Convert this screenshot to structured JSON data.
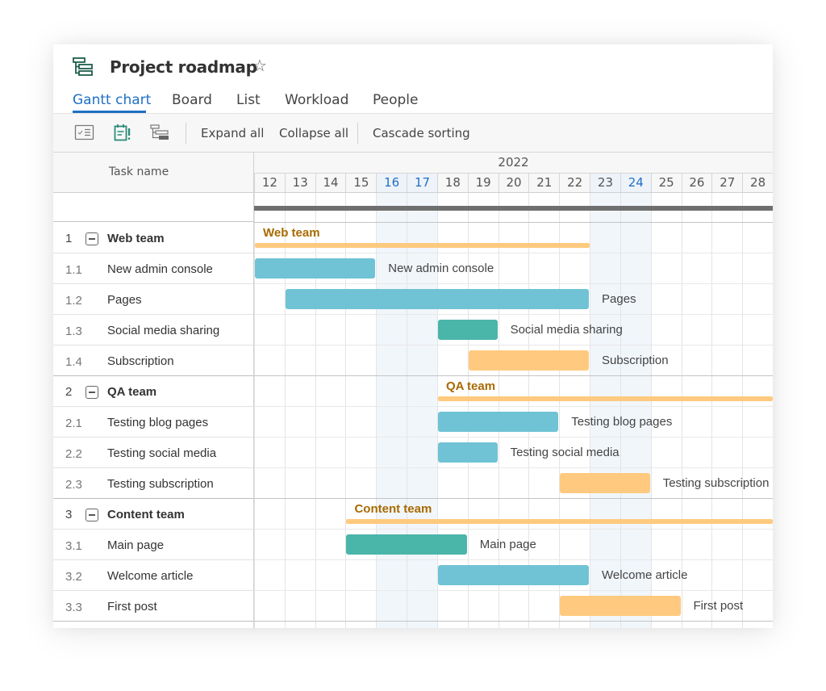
{
  "header": {
    "title": "Project roadmap",
    "app_icon": "gantt-icon",
    "favorite_icon": "star-icon"
  },
  "tabs": [
    {
      "label": "Gantt chart",
      "active": true
    },
    {
      "label": "Board",
      "active": false
    },
    {
      "label": "List",
      "active": false
    },
    {
      "label": "Workload",
      "active": false
    },
    {
      "label": "People",
      "active": false
    }
  ],
  "toolbar": {
    "icons": [
      "task-list-icon",
      "calendar-alert-icon",
      "hierarchy-icon"
    ],
    "expand_all": "Expand all",
    "collapse_all": "Collapse all",
    "cascade_sorting": "Cascade sorting"
  },
  "grid": {
    "task_name_header": "Task name",
    "year": "2022"
  },
  "colors": {
    "accent": "#1f6fc5",
    "bar_blue": "#6fc3d4",
    "bar_teal": "#4ab5a9",
    "bar_orange": "#ffca7f",
    "summary": "#ffca7f",
    "group_label": "#a86a00",
    "project_bar": "#6f6f6f"
  },
  "chart_data": {
    "type": "gantt",
    "year": "2022",
    "days": [
      12,
      13,
      14,
      15,
      16,
      17,
      18,
      19,
      20,
      21,
      22,
      23,
      24,
      25,
      26,
      27,
      28
    ],
    "highlighted_days": [
      16,
      17,
      24
    ],
    "weekend_days": [
      16,
      17,
      23,
      24
    ],
    "groups": [
      {
        "id": "1",
        "name": "Web team",
        "start": 12,
        "end": 22,
        "tasks": [
          {
            "id": "1.1",
            "name": "New admin console",
            "start": 12,
            "end": 15,
            "color": "blue"
          },
          {
            "id": "1.2",
            "name": "Pages",
            "start": 13,
            "end": 22,
            "color": "blue"
          },
          {
            "id": "1.3",
            "name": "Social media sharing",
            "start": 18,
            "end": 19,
            "color": "teal"
          },
          {
            "id": "1.4",
            "name": "Subscription",
            "start": 19,
            "end": 22,
            "color": "orange"
          }
        ]
      },
      {
        "id": "2",
        "name": "QA team",
        "start": 18,
        "end": 28,
        "tasks": [
          {
            "id": "2.1",
            "name": "Testing blog pages",
            "start": 18,
            "end": 21,
            "color": "blue"
          },
          {
            "id": "2.2",
            "name": "Testing social media",
            "start": 18,
            "end": 19,
            "color": "blue"
          },
          {
            "id": "2.3",
            "name": "Testing subscription",
            "start": 22,
            "end": 24,
            "color": "orange"
          }
        ]
      },
      {
        "id": "3",
        "name": "Content team",
        "start": 15,
        "end": 28,
        "tasks": [
          {
            "id": "3.1",
            "name": "Main page",
            "start": 15,
            "end": 18,
            "color": "teal"
          },
          {
            "id": "3.2",
            "name": "Welcome article",
            "start": 18,
            "end": 22,
            "color": "blue"
          },
          {
            "id": "3.3",
            "name": "First post",
            "start": 22,
            "end": 25,
            "color": "orange"
          }
        ]
      }
    ]
  }
}
